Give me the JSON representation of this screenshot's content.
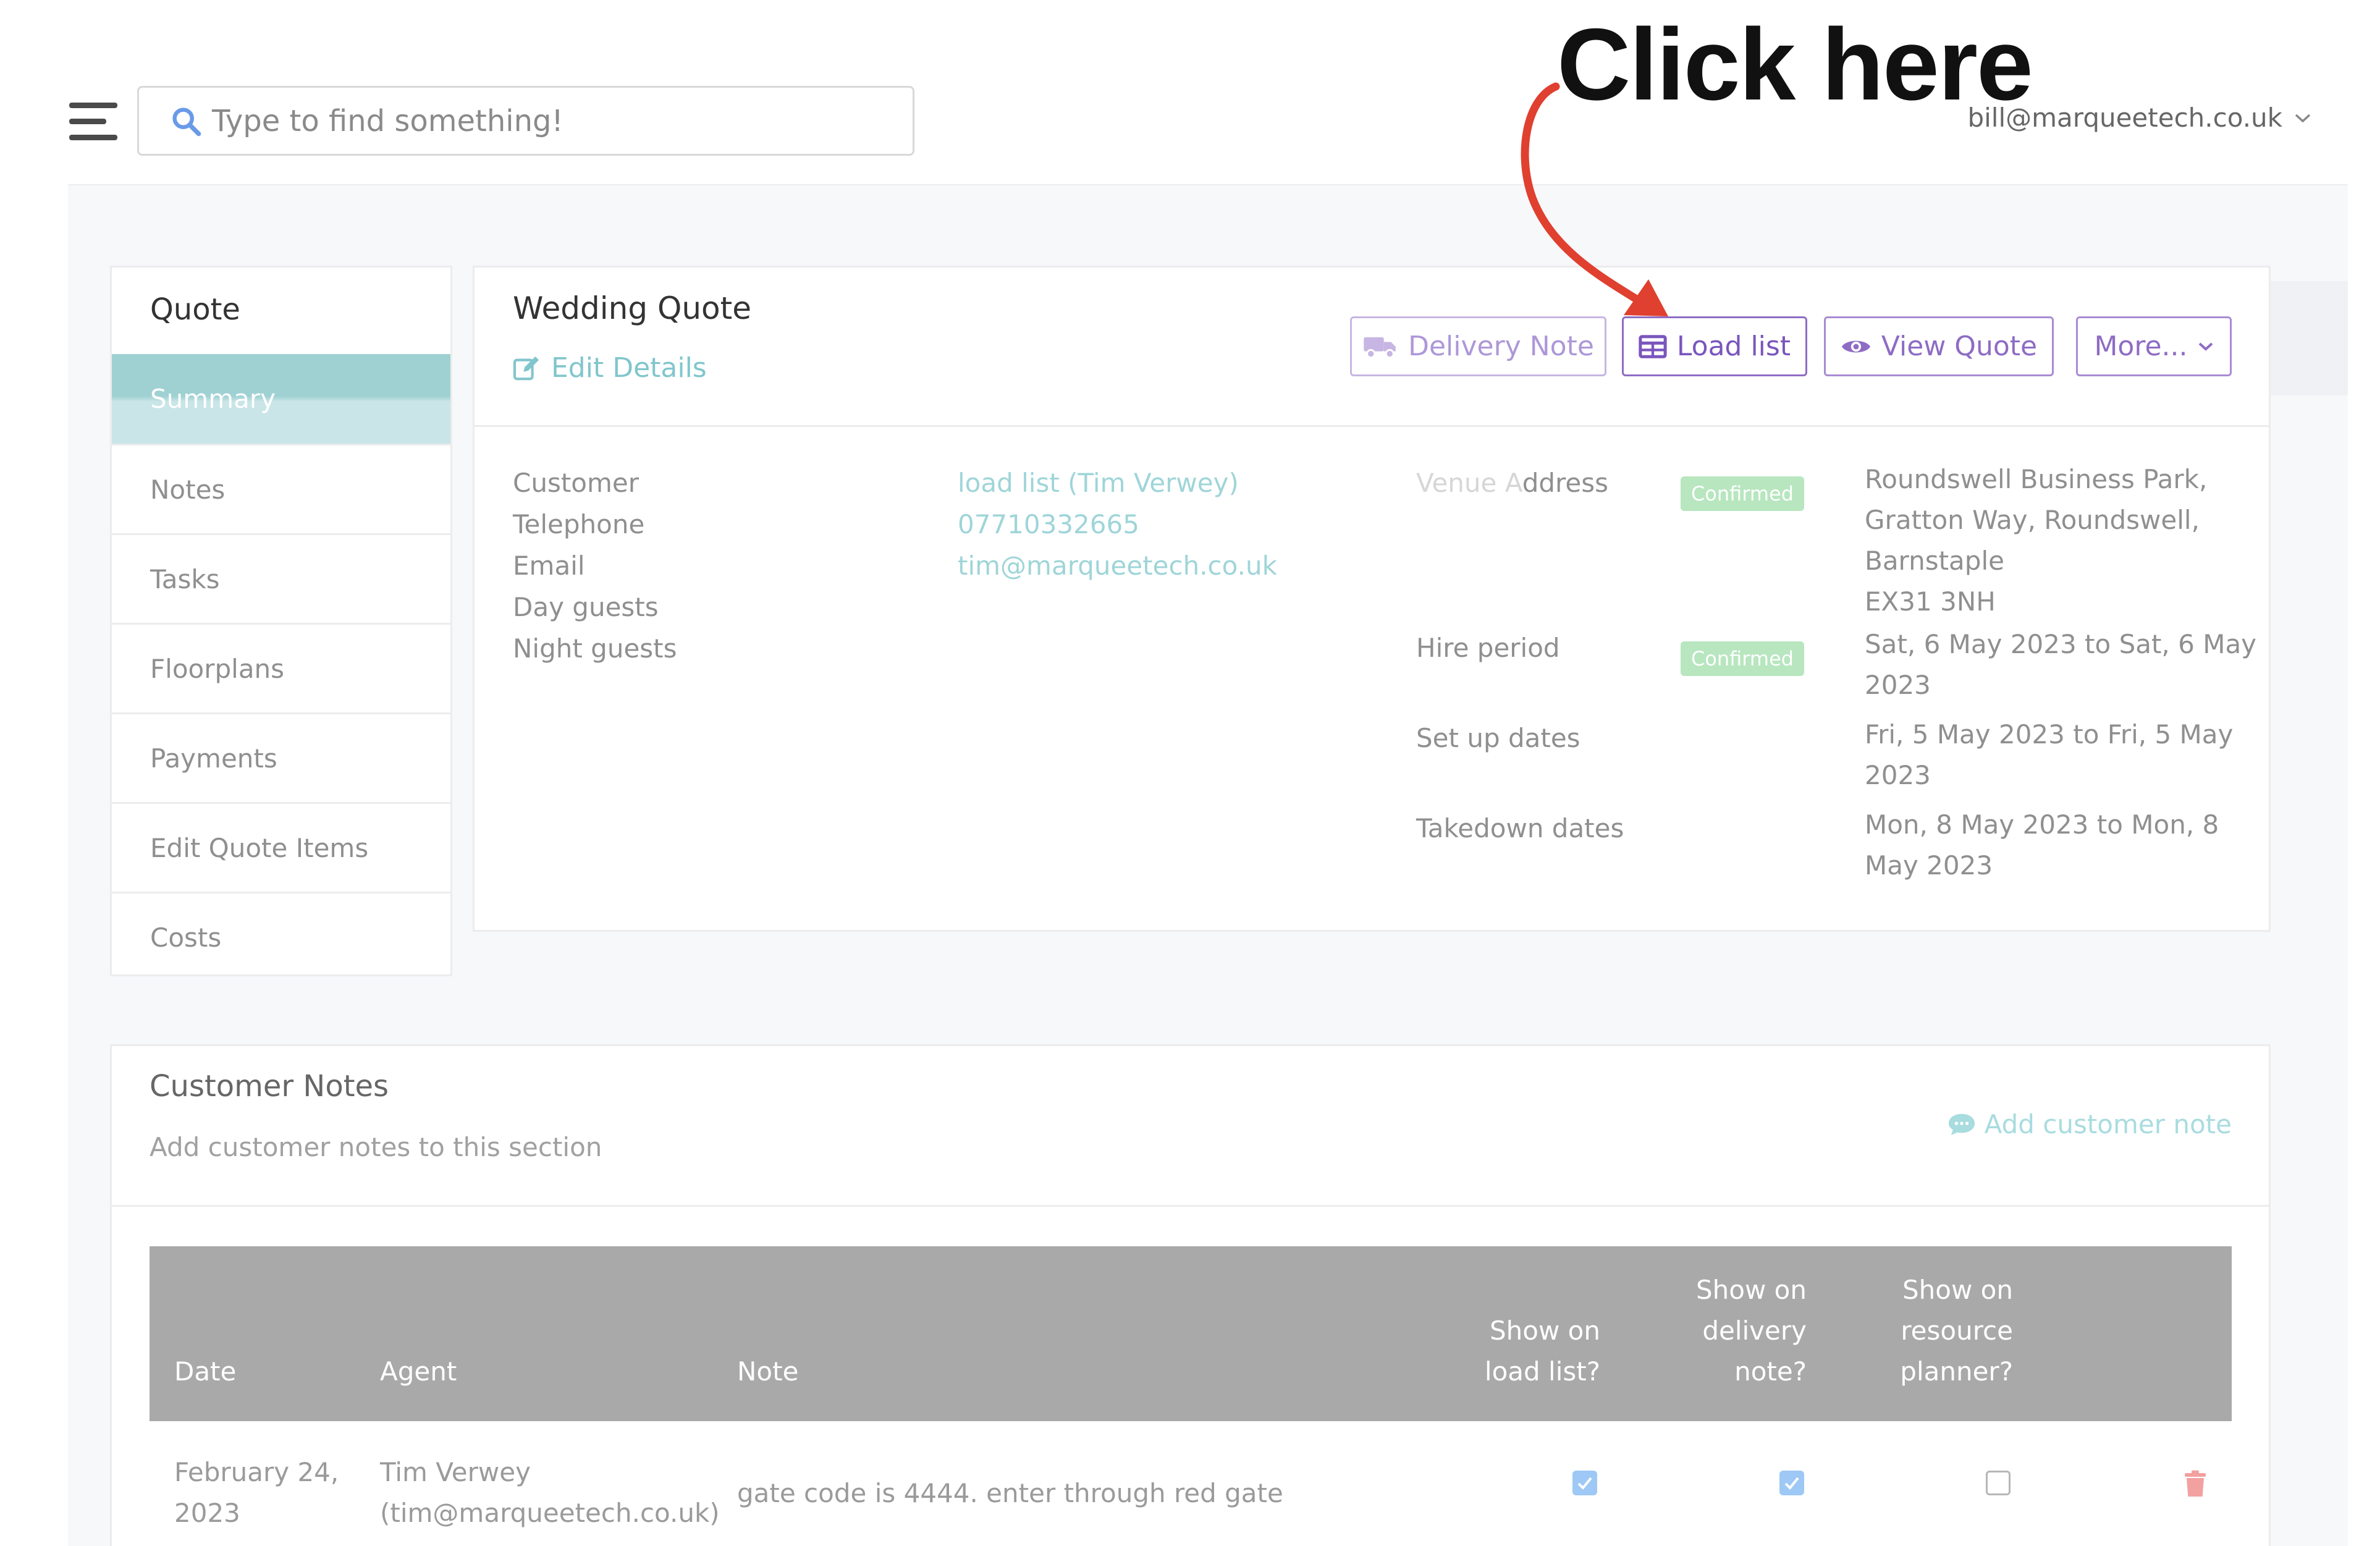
{
  "search": {
    "placeholder": "Type to find something!"
  },
  "user": {
    "email": "bill@marqueetech.co.uk"
  },
  "annotation": {
    "text": "Click here"
  },
  "sidebar": {
    "title": "Quote",
    "items": [
      {
        "label": "Summary"
      },
      {
        "label": "Notes"
      },
      {
        "label": "Tasks"
      },
      {
        "label": "Floorplans"
      },
      {
        "label": "Payments"
      },
      {
        "label": "Edit Quote Items"
      },
      {
        "label": "Costs"
      }
    ]
  },
  "quote": {
    "title": "Wedding Quote",
    "edit_label": "Edit Details",
    "buttons": {
      "delivery_note": "Delivery Note",
      "load_list": "Load list",
      "view_quote": "View Quote",
      "more": "More..."
    },
    "details": {
      "customer_label": "Customer",
      "telephone_label": "Telephone",
      "email_label": "Email",
      "day_guests_label": "Day guests",
      "night_guests_label": "Night guests",
      "customer_value": "load list (Tim Verwey)",
      "telephone_value": "07710332665",
      "email_value": "tim@marqueetech.co.uk"
    },
    "venue": {
      "venue_label_light": "Venue A",
      "venue_label_dark": "ddress",
      "venue_status": "Confirmed",
      "venue_lines": [
        "Roundswell Business Park,",
        "Gratton Way, Roundswell,",
        "Barnstaple",
        "EX31 3NH"
      ],
      "hire_label": "Hire period",
      "hire_status": "Confirmed",
      "hire_lines": [
        "Sat, 6 May 2023 to Sat, 6 May",
        "2023"
      ],
      "setup_label": "Set up dates",
      "setup_lines": [
        "Fri, 5 May 2023 to Fri, 5 May",
        "2023"
      ],
      "takedown_label": "Takedown dates",
      "takedown_lines": [
        "Mon, 8 May 2023 to Mon, 8",
        "May 2023"
      ]
    }
  },
  "customer_notes": {
    "title": "Customer Notes",
    "subtitle": "Add customer notes to this section",
    "add_label": "Add customer note",
    "columns": {
      "date": "Date",
      "agent": "Agent",
      "note": "Note",
      "load_list": [
        "Show on",
        "load list?"
      ],
      "delivery": [
        "Show on",
        "delivery",
        "note?"
      ],
      "resource": [
        "Show on",
        "resource",
        "planner?"
      ]
    },
    "rows": [
      {
        "date": [
          "February 24,",
          "2023"
        ],
        "agent": [
          "Tim Verwey",
          "(tim@marqueetech.co.uk)"
        ],
        "note": "gate code is 4444. enter through red gate",
        "show_load_list": true,
        "show_delivery": true,
        "show_resource": false
      }
    ]
  }
}
